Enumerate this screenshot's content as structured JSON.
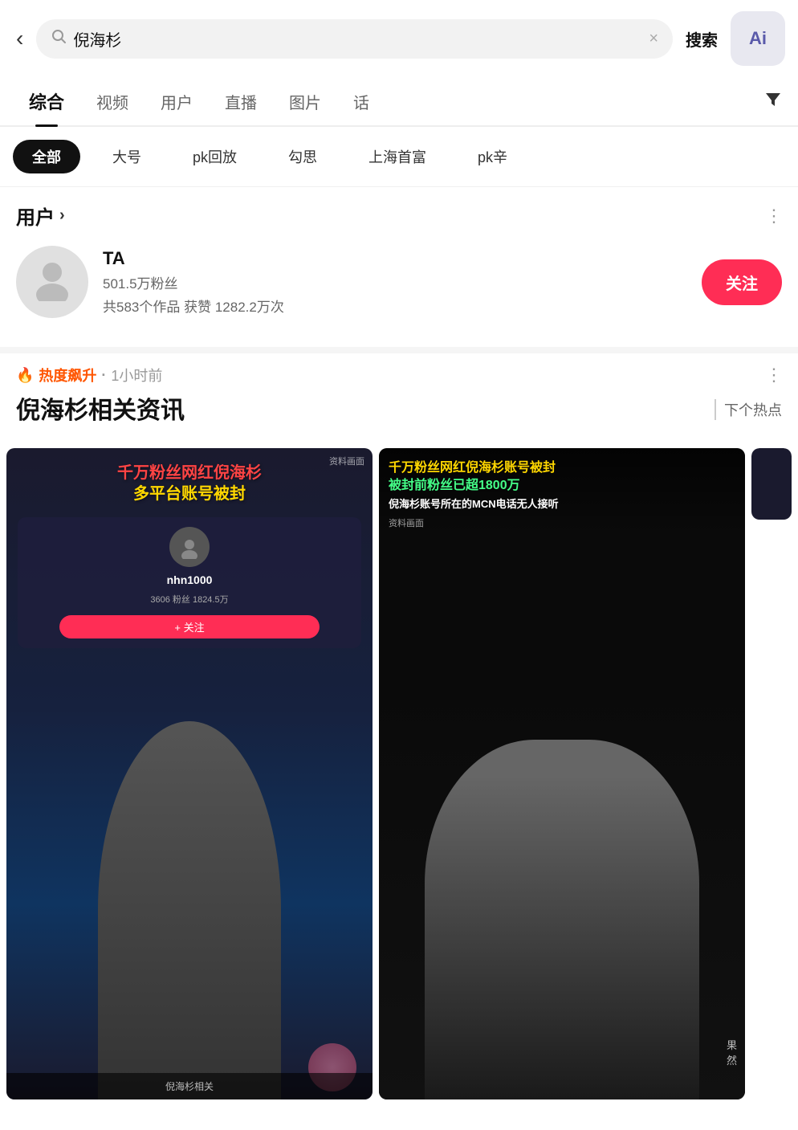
{
  "header": {
    "back_label": "‹",
    "search_placeholder": "倪海杉",
    "search_value": "倪海杉",
    "clear_icon": "×",
    "search_btn_label": "搜索",
    "ai_label": "Ai"
  },
  "tabs": {
    "items": [
      {
        "label": "综合",
        "active": true
      },
      {
        "label": "视频",
        "active": false
      },
      {
        "label": "用户",
        "active": false
      },
      {
        "label": "直播",
        "active": false
      },
      {
        "label": "图片",
        "active": false
      },
      {
        "label": "话",
        "active": false
      }
    ],
    "filter_icon": "▼"
  },
  "sub_filters": {
    "items": [
      {
        "label": "全部",
        "active": true
      },
      {
        "label": "大号",
        "active": false
      },
      {
        "label": "pk回放",
        "active": false
      },
      {
        "label": "勾思",
        "active": false
      },
      {
        "label": "上海首富",
        "active": false
      },
      {
        "label": "pk辛",
        "active": false
      }
    ]
  },
  "user_section": {
    "title": "用户",
    "arrow": "›",
    "more_icon": "⋮",
    "user": {
      "name": "TA",
      "fans": "501.5万粉丝",
      "works": "共583个作品",
      "likes": "获赞 1282.2万次",
      "follow_label": "关注"
    }
  },
  "hot_section": {
    "fire_emoji": "🔥",
    "hot_label": "热度飙升",
    "dot": "·",
    "time_ago": "1小时前",
    "more_icon": "⋮",
    "title": "倪海杉相关资讯",
    "next_hot": "下个热点"
  },
  "video_cards": [
    {
      "headline_line1": "千万粉丝网红倪海杉",
      "headline_line2": "多平台账号被封",
      "source_label": "资料画面",
      "username": "nhn1000",
      "stats": "3606 粉丝  1824.5万",
      "follow_label": "+ 关注"
    },
    {
      "headline_line1": "千万粉丝网红倪海杉账号被封",
      "headline_line2": "被封前粉丝已超1800万",
      "headline_line3": "倪海杉账号所在的MCN电话无人接听",
      "source_label": "资料画面",
      "watermark": "果\n然"
    }
  ],
  "colors": {
    "accent_red": "#ff2d55",
    "hot_orange": "#ff5500",
    "gold": "#ffd700",
    "bg_light": "#f5f5f5"
  }
}
